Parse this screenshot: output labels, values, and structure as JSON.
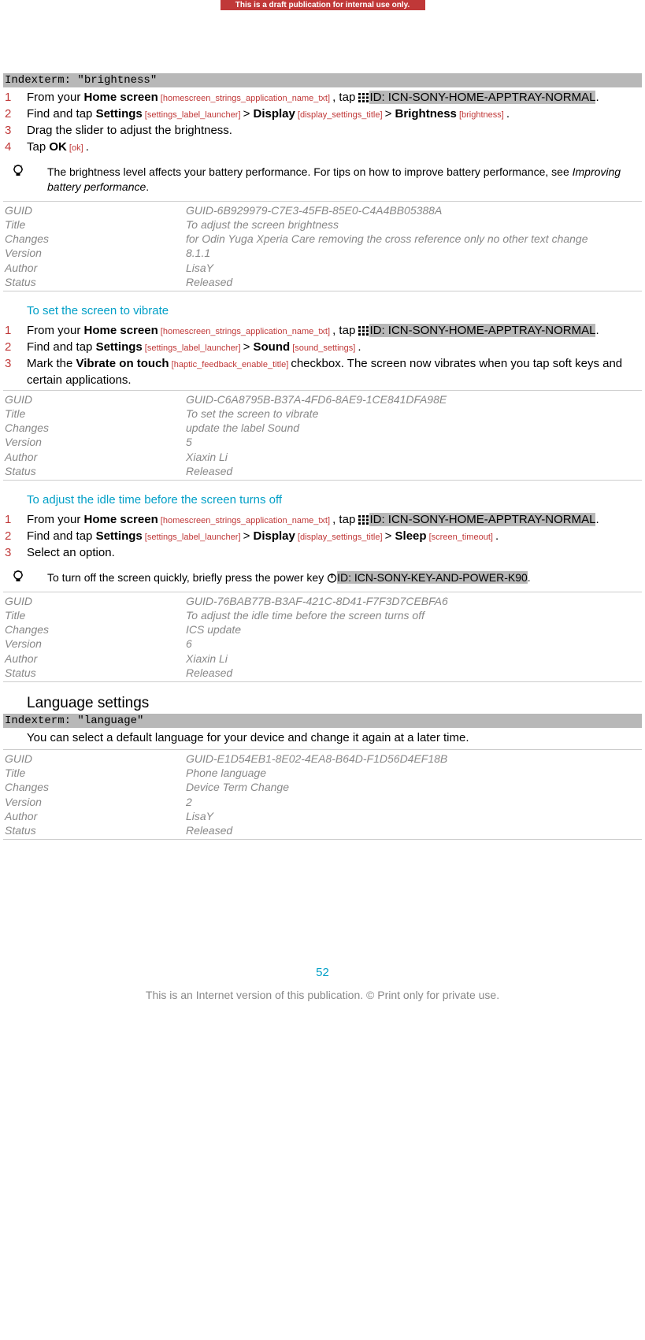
{
  "banner": "This is a draft publication for internal use only.",
  "indexterm_brightness": "Indexterm: \"brightness\"",
  "s1": {
    "step1_a": "From your ",
    "step1_b": "Home screen",
    "step1_ref": " [homescreen_strings_application_name_txt] ",
    "step1_c": ", tap ",
    "step1_hl": "ID: ICN-SONY-HOME-APPTRAY-NORMAL",
    "step1_d": ".",
    "step2_a": "Find and tap ",
    "step2_b": "Settings",
    "step2_ref1": " [settings_label_launcher] ",
    "step2_c": "> ",
    "step2_d": "Display",
    "step2_ref2": " [display_settings_title] ",
    "step2_e": "> ",
    "step2_f": "Brightness",
    "step2_ref3": " [brightness] ",
    "step2_g": ".",
    "step3": "Drag the slider to adjust the brightness.",
    "step4_a": "Tap ",
    "step4_b": "OK",
    "step4_ref": " [ok] ",
    "step4_c": "."
  },
  "hint1_a": "The brightness level affects your battery performance. For tips on how to improve battery performance, see ",
  "hint1_b": "Improving battery performance",
  "hint1_c": ".",
  "meta1": {
    "guid": "GUID-6B929979-C7E3-45FB-85E0-C4A4BB05388A",
    "title": "To adjust the screen brightness",
    "changes": "for Odin Yuga Xperia Care removing the cross reference only no other text change",
    "version": "8.1.1",
    "author": "LisaY",
    "status": "Released"
  },
  "labels": {
    "guid": "GUID",
    "title": "Title",
    "changes": "Changes",
    "version": "Version",
    "author": "Author",
    "status": "Status"
  },
  "subhead_vibrate": "To set the screen to vibrate",
  "s2": {
    "step1_a": "From your ",
    "step1_b": "Home screen",
    "step1_ref": " [homescreen_strings_application_name_txt] ",
    "step1_c": ", tap ",
    "step1_hl": "ID: ICN-SONY-HOME-APPTRAY-NORMAL",
    "step1_d": ".",
    "step2_a": "Find and tap ",
    "step2_b": "Settings",
    "step2_ref1": " [settings_label_launcher] ",
    "step2_c": "> ",
    "step2_d": "Sound",
    "step2_ref2": " [sound_settings] ",
    "step2_e": ".",
    "step3_a": "Mark the ",
    "step3_b": "Vibrate on touch",
    "step3_ref": " [haptic_feedback_enable_title] ",
    "step3_c": "checkbox. The screen now vibrates when you tap soft keys and certain applications."
  },
  "meta2": {
    "guid": "GUID-C6A8795B-B37A-4FD6-8AE9-1CE841DFA98E",
    "title": "To set the screen to vibrate",
    "changes": "update the label Sound",
    "version": "5",
    "author": "Xiaxin Li",
    "status": "Released"
  },
  "subhead_idle": "To adjust the idle time before the screen turns off",
  "s3": {
    "step1_a": "From your ",
    "step1_b": "Home screen",
    "step1_ref": " [homescreen_strings_application_name_txt] ",
    "step1_c": ", tap ",
    "step1_hl": "ID: ICN-SONY-HOME-APPTRAY-NORMAL",
    "step1_d": ".",
    "step2_a": "Find and tap ",
    "step2_b": "Settings",
    "step2_ref1": " [settings_label_launcher] ",
    "step2_c": "> ",
    "step2_d": "Display",
    "step2_ref2": " [display_settings_title] ",
    "step2_e": "> ",
    "step2_f": "Sleep",
    "step2_ref3": " [screen_timeout] ",
    "step2_g": ".",
    "step3": "Select an option."
  },
  "hint2_a": "To turn off the screen quickly, briefly press the power key ",
  "hint2_hl": "ID: ICN-SONY-KEY-AND-POWER-K90",
  "hint2_b": ".",
  "meta3": {
    "guid": "GUID-76BAB77B-B3AF-421C-8D41-F7F3D7CEBFA6",
    "title": "To adjust the idle time before the screen turns off",
    "changes": "ICS update",
    "version": "6",
    "author": "Xiaxin Li",
    "status": "Released"
  },
  "h2_lang": "Language settings",
  "indexterm_lang": "Indexterm: \"language\"",
  "lang_body": "You can select a default language for your device and change it again at a later time.",
  "meta4": {
    "guid": "GUID-E1D54EB1-8E02-4EA8-B64D-F1D56D4EF18B",
    "title": "Phone language",
    "changes": "Device Term Change",
    "version": "2",
    "author": "LisaY",
    "status": "Released"
  },
  "pagenum": "52",
  "footer": "This is an Internet version of this publication. © Print only for private use."
}
